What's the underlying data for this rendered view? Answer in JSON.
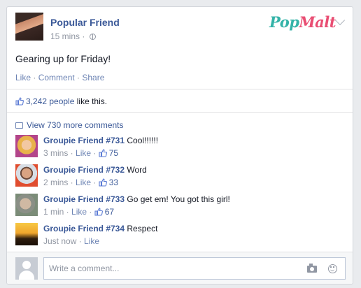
{
  "post": {
    "author": "Popular Friend",
    "time": "15 mins",
    "separator": " · ",
    "text": "Gearing up for Friday!",
    "actions": [
      "Like",
      "Comment",
      "Share"
    ]
  },
  "brand": {
    "pop": "Pop",
    "malt": "Malt"
  },
  "likes": {
    "count": "3,242 people",
    "suffix": " like this."
  },
  "view_more": "View 730 more comments",
  "comments": [
    {
      "name": "Groupie Friend #731",
      "text": "Cool!!!!!!",
      "time": "3 mins",
      "like": "Like",
      "likes": "75"
    },
    {
      "name": "Groupie Friend #732",
      "text": "Word",
      "time": "2 mins",
      "like": "Like",
      "likes": "33"
    },
    {
      "name": "Groupie Friend #733",
      "text": "Go get em! You got this girl!",
      "time": "1 min",
      "like": "Like",
      "likes": "67"
    },
    {
      "name": "Groupie Friend #734",
      "text": "Respect",
      "time": "Just now",
      "like": "Like",
      "likes": ""
    }
  ],
  "composer": {
    "placeholder": "Write a comment..."
  },
  "colors": {
    "link": "#3b5998",
    "meta": "#9197a3",
    "pop": "#34b3a8",
    "malt": "#e94e73"
  },
  "icons": [
    "globe-icon",
    "thumbs-up-icon",
    "comment-bubble-icon",
    "camera-icon",
    "smiley-icon",
    "chevron-down-icon"
  ]
}
